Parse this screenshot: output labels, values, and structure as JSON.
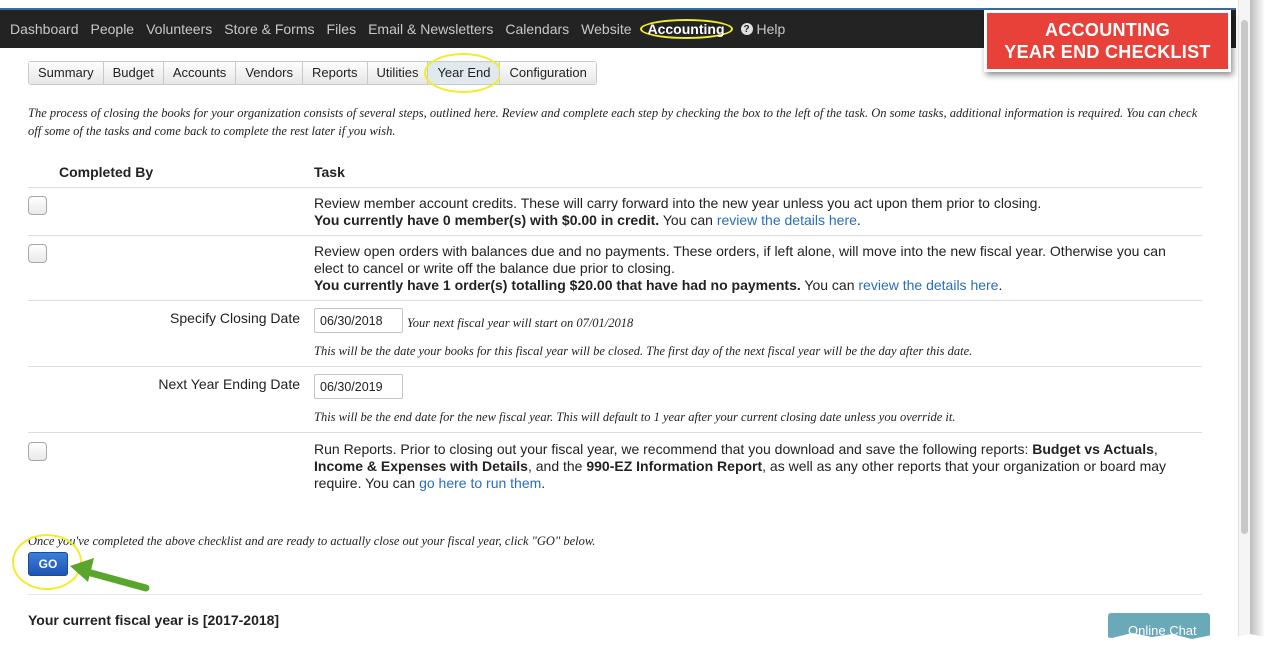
{
  "nav": {
    "items": [
      "Dashboard",
      "People",
      "Volunteers",
      "Store & Forms",
      "Files",
      "Email & Newsletters",
      "Calendars",
      "Website"
    ],
    "active": "Accounting",
    "help": "Help"
  },
  "callout": {
    "line1": "ACCOUNTING",
    "line2": "YEAR END CHECKLIST"
  },
  "tabs": [
    "Summary",
    "Budget",
    "Accounts",
    "Vendors",
    "Reports",
    "Utilities",
    "Year End",
    "Configuration"
  ],
  "active_tab": "Year End",
  "intro": "The process of closing the books for your organization consists of several steps, outlined here. Review and complete each step by checking the box to the left of the task. On some tasks, additional information is required. You can check off some of the tasks and come back to complete the rest later if you wish.",
  "table": {
    "col_completed": "Completed By",
    "col_task": "Task"
  },
  "task1": {
    "text": "Review member account credits. These will carry forward into the new year unless you act upon them prior to closing.",
    "bold": "You currently have 0 member(s) with $0.00 in credit.",
    "pre_link": " You can ",
    "link": "review the details here",
    "post": "."
  },
  "task2": {
    "text": "Review open orders with balances due and no payments. These orders, if left alone, will move into the new fiscal year. Otherwise you can elect to cancel or write off the balance due prior to closing.",
    "bold": "You currently have 1 order(s) totalling $20.00 that have had no payments.",
    "pre_link": " You can ",
    "link": "review the details here",
    "post": "."
  },
  "closing": {
    "label": "Specify Closing Date",
    "value": "06/30/2018",
    "inline_note": "Your next fiscal year will start on 07/01/2018",
    "note": "This will be the date your books for this fiscal year will be closed. The first day of the next fiscal year will be the day after this date."
  },
  "next_year": {
    "label": "Next Year Ending Date",
    "value": "06/30/2019",
    "note": "This will be the end date for the new fiscal year. This will default to 1 year after your current closing date unless you override it."
  },
  "task3": {
    "pre": "Run Reports. Prior to closing out your fiscal year, we recommend that you download and save the following reports: ",
    "b1": "Budget vs Actuals",
    "sep1": ", ",
    "b2": "Income & Expenses with Details",
    "sep2": ", and the ",
    "b3": "990-EZ Information Report",
    "mid": ", as well as any other reports that your organization or board may require. You can ",
    "link": "go here to run them",
    "post": "."
  },
  "go_note": "Once you've completed the above checklist and are ready to actually close out your fiscal year, click \"GO\" below.",
  "go_label": "GO",
  "fiscal_year": "Your current fiscal year is [2017-2018]",
  "online_chat": "Online Chat",
  "colors": {
    "accent_yellow": "#f2ec2a",
    "callout_red": "#e8413a",
    "arrow_green": "#5aa52c",
    "link_blue": "#2a6ebb",
    "go_blue": "#1d55b5"
  }
}
